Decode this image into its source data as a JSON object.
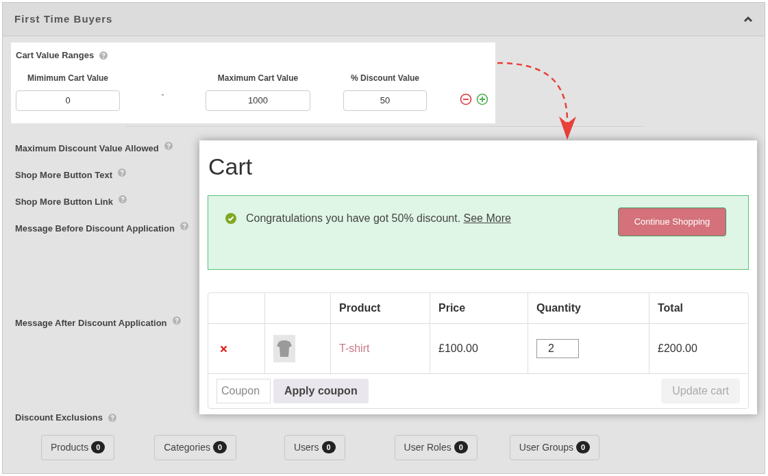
{
  "panel": {
    "title": "First Time Buyers",
    "expanded": true
  },
  "cart_value_ranges": {
    "label": "Cart Value Ranges",
    "fields": [
      {
        "label": "Mimimum Cart Value",
        "value": "0"
      },
      {
        "label": "Maximum Cart Value",
        "value": "1000"
      },
      {
        "label": "% Discount Value",
        "value": "50"
      }
    ],
    "separator": "-"
  },
  "settings": [
    {
      "label": "Maximum Discount Value Allowed",
      "kind": "text"
    },
    {
      "label": "Shop More Button Text",
      "kind": "text"
    },
    {
      "label": "Shop More Button Link",
      "kind": "text"
    },
    {
      "label": "Message Before Discount Application",
      "kind": "textarea"
    },
    {
      "label": "Message After Discount Application",
      "kind": "textarea"
    }
  ],
  "discount_exclusions": {
    "label": "Discount Exclusions",
    "buttons": [
      {
        "label": "Products",
        "count": "0"
      },
      {
        "label": "Categories",
        "count": "0"
      },
      {
        "label": "Users",
        "count": "0"
      },
      {
        "label": "User Roles",
        "count": "0"
      },
      {
        "label": "User Groups",
        "count": "0"
      }
    ]
  },
  "cart_preview": {
    "title": "Cart",
    "notice": {
      "message": "Congratulations you have got 50% discount.",
      "link": "See More",
      "button": "Continue Shopping"
    },
    "table": {
      "columns": [
        "Product",
        "Price",
        "Quantity",
        "Total"
      ],
      "rows": [
        {
          "product": "T-shirt",
          "price": "£100.00",
          "quantity": "2",
          "total": "£200.00"
        }
      ]
    },
    "coupon_placeholder": "Coupon",
    "apply_button": "Apply coupon",
    "update_button": {
      "label": "Update cart",
      "disabled": true
    }
  }
}
